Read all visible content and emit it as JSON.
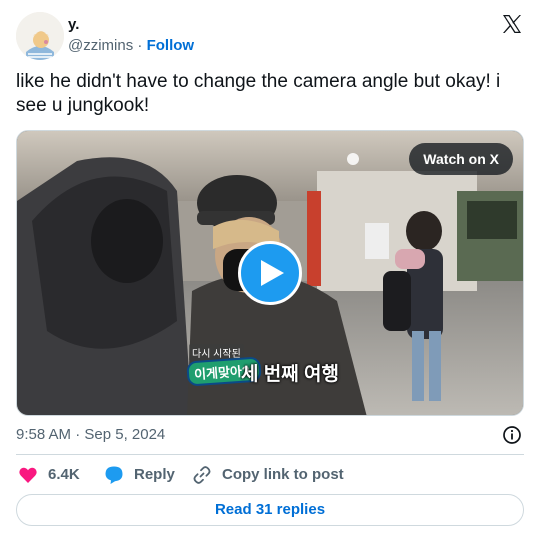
{
  "author": {
    "display_name": "y.",
    "handle": "@zzimins",
    "separator": "·",
    "follow_label": "Follow"
  },
  "tweet": {
    "text": "like he didn't have to change the camera angle but okay! i see u jungkook!"
  },
  "media": {
    "watch_label": "Watch on X",
    "caption_small": "다시 시작된",
    "caption_badge": "이게맞아?!",
    "caption_main": "세 번째 여행"
  },
  "meta": {
    "timestamp": "9:58 AM · Sep 5, 2024"
  },
  "actions": {
    "like_count": "6.4K",
    "reply_label": "Reply",
    "copy_label": "Copy link to post"
  },
  "read_replies_label": "Read 31 replies",
  "colors": {
    "accent": "#1d9bf0",
    "link": "#006fd6",
    "like": "#f91880",
    "muted": "#536471"
  },
  "icons": [
    "x-logo-icon",
    "play-icon",
    "info-icon",
    "heart-icon",
    "reply-bubble-icon",
    "link-icon"
  ]
}
